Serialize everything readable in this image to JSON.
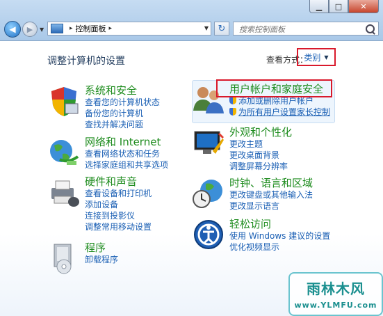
{
  "window": {
    "min_glyph": "▁",
    "max_glyph": "□",
    "close_glyph": "✕"
  },
  "nav": {
    "back_glyph": "◀",
    "forward_glyph": "▶",
    "dropdown_glyph": "▼"
  },
  "address": {
    "separator": "▸",
    "path": "控制面板",
    "refresh_glyph": "↻"
  },
  "search": {
    "placeholder": "搜索控制面板"
  },
  "page": {
    "title": "调整计算机的设置",
    "view_by_label": "查看方式：",
    "view_by_value": "类别",
    "view_by_caret": "▼"
  },
  "categories": [
    {
      "title": "系统和安全",
      "links": [
        "查看您的计算机状态",
        "备份您的计算机",
        "查找并解决问题"
      ]
    },
    {
      "title": "网络和 Internet",
      "links": [
        "查看网络状态和任务",
        "选择家庭组和共享选项"
      ]
    },
    {
      "title": "硬件和声音",
      "links": [
        "查看设备和打印机",
        "添加设备",
        "连接到投影仪",
        "调整常用移动设置"
      ]
    },
    {
      "title": "程序",
      "links": [
        "卸载程序"
      ]
    },
    {
      "title": "用户帐户和家庭安全",
      "links": [
        "添加或删除用户帐户",
        "为所有用户设置家长控制"
      ]
    },
    {
      "title": "外观和个性化",
      "links": [
        "更改主题",
        "更改桌面背景",
        "调整屏幕分辨率"
      ]
    },
    {
      "title": "时钟、语言和区域",
      "links": [
        "更改键盘或其他输入法",
        "更改显示语言"
      ]
    },
    {
      "title": "轻松访问",
      "links": [
        "使用 Windows 建议的设置",
        "优化视频显示"
      ]
    }
  ],
  "watermark": {
    "title": "雨林木风",
    "url": "www.YLMFU.com"
  },
  "colors": {
    "category_title": "#1e8c1e",
    "link": "#1a5fb4",
    "highlight": "#d9192b",
    "titlebar": "#b9d3ee"
  },
  "icons": [
    "system-security-icon",
    "network-globe-icon",
    "hardware-printer-icon",
    "programs-disc-icon",
    "user-accounts-icon",
    "appearance-monitor-icon",
    "clock-globe-icon",
    "ease-of-access-icon"
  ]
}
